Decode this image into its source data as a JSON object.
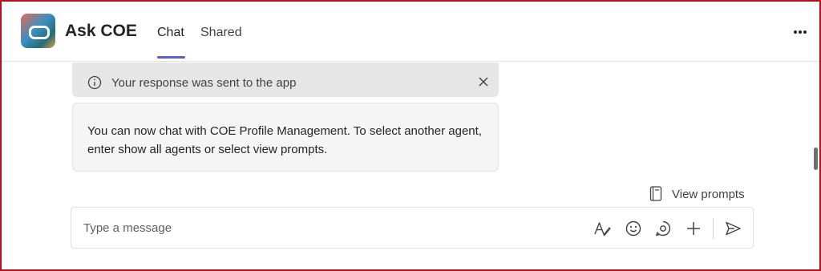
{
  "header": {
    "app_title": "Ask COE",
    "app_icon": "ask-coe-app-icon",
    "tabs": [
      {
        "label": "Chat",
        "active": true
      },
      {
        "label": "Shared",
        "active": false
      }
    ],
    "more_icon": "more-horizontal-icon"
  },
  "conversation": {
    "notice": {
      "icon": "info-icon",
      "text": "Your response was sent to the app",
      "close_icon": "close-icon"
    },
    "message": {
      "text": "You can now chat with COE Profile Management. To select another agent, enter show all agents or select view prompts."
    }
  },
  "view_prompts": {
    "icon": "book-icon",
    "label": "View prompts"
  },
  "composer": {
    "placeholder": "Type a message",
    "value": "",
    "tools": [
      "format-icon",
      "emoji-icon",
      "loop-icon",
      "add-icon",
      "send-icon"
    ]
  },
  "colors": {
    "accent": "#5b5fc7",
    "frame_border": "#b3111d",
    "notice_bg": "#e6e6e6",
    "bubble_bg": "#f5f5f5"
  }
}
